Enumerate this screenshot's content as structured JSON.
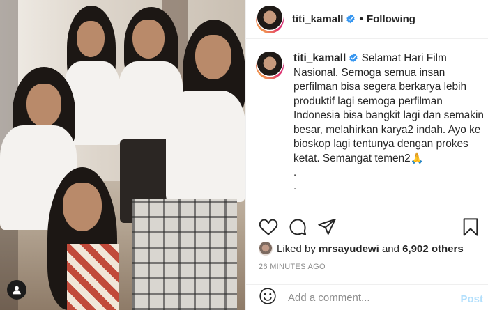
{
  "post": {
    "username": "titi_kamall",
    "separator": "•",
    "follow_state": "Following",
    "caption_username": "titi_kamall",
    "caption_text": "Selamat Hari Film Nasional. Semoga semua insan perfilman bisa segera berkarya lebih produktif lagi semoga perfilman Indonesia bisa bangkit lagi dan semakin besar, melahirkan karya2 indah. Ayo ke bioskop lagi tentunya dengan prokes ketat. Semangat temen2🙏",
    "caption_dot_1": ".",
    "caption_dot_2": "."
  },
  "likes": {
    "prefix": "Liked by ",
    "user": "mrsayudewi",
    "middle": " and ",
    "count": "6,902 others"
  },
  "timestamp": "26 MINUTES AGO",
  "comment": {
    "placeholder": "Add a comment...",
    "post_label": "Post"
  },
  "icons": {
    "like": "heart-icon",
    "comment": "comment-icon",
    "share": "paper-plane-icon",
    "save": "bookmark-icon",
    "emoji": "smiley-icon",
    "tagged": "user-icon",
    "verified": "verified-badge-icon"
  },
  "colors": {
    "verified": "#3897f0",
    "post_disabled": "#b2dffc",
    "muted": "#8e8e8e"
  }
}
